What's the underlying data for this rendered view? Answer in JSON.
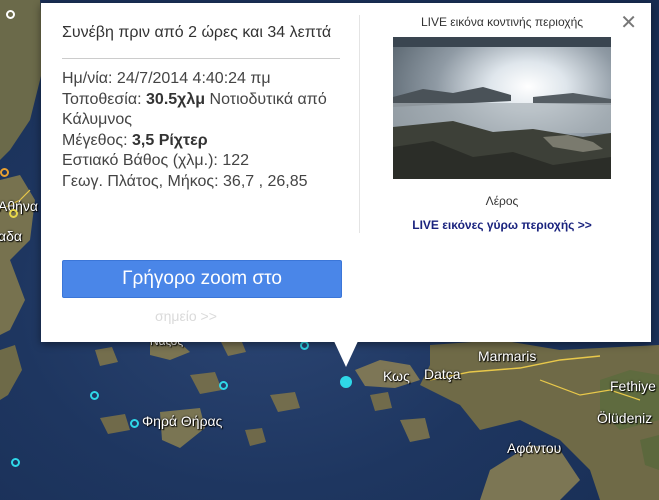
{
  "map": {
    "labels": {
      "athina": "Αθήνα",
      "athina_partial": "αδα",
      "naxos": "Νάξος",
      "fira": "Φηρά Θήρας",
      "kos": "Κως",
      "datca": "Datça",
      "marmaris": "Marmaris",
      "fethiye": "Fethiye",
      "oludeniz": "Ölüdeniz",
      "afantou": "Αφάντου"
    }
  },
  "popup": {
    "title": "Συνέβη πριν από 2 ώρες και 34 λεπτά",
    "date_label": "Ημ/νία:",
    "date_value": "24/7/2014 4:40:24 πμ",
    "location_label": "Τοποθεσία:",
    "location_distance": "30.5χλμ",
    "location_text": "Νοτιοδυτικά από Κάλυμνος",
    "magnitude_label": "Μέγεθος:",
    "magnitude_value": "3,5 Ρίχτερ",
    "depth_label": "Εστιακό Βάθος (χλμ.):",
    "depth_value": "122",
    "coords_label": "Γεωγ. Πλάτος, Μήκος:",
    "coords_value": "36,7 , 26,85",
    "zoom_button": "Γρήγορο zoom στο",
    "zoom_link": "σημείο >>",
    "close": "✕",
    "webcam": {
      "title": "LIVE εικόνα κοντινής περιοχής",
      "caption": "Λέρος",
      "live_link": "LIVE εικόνες γύρω περιοχής >>"
    }
  }
}
